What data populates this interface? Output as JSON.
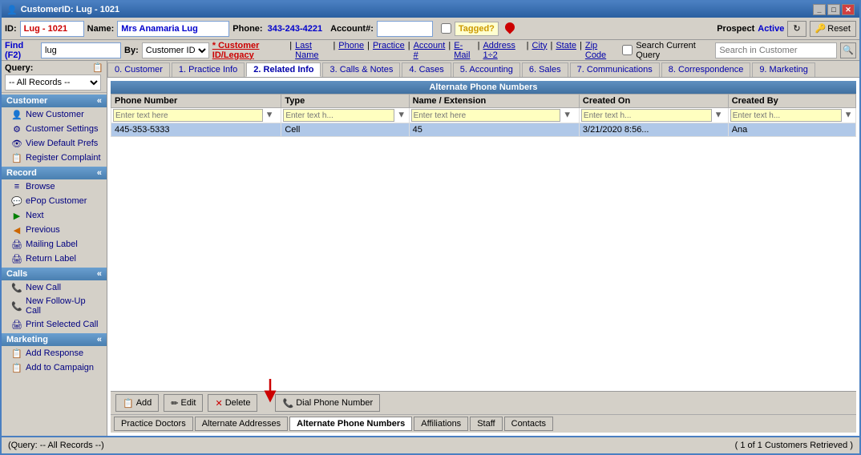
{
  "titleBar": {
    "title": "CustomerID: Lug - 1021",
    "controls": [
      "_",
      "□",
      "✕"
    ]
  },
  "idBar": {
    "idLabel": "ID:",
    "idValue": "Lug - 1021",
    "nameLabel": "Name:",
    "nameValue": "Mrs Anamaria Lug",
    "phoneLabel": "Phone:",
    "phoneValue": "343-243-4221",
    "accountLabel": "Account#:",
    "accountValue": "",
    "taggedLabel": "Tagged?",
    "prospectLabel": "Prospect",
    "activeLabel": "Active",
    "refreshLabel": "↻",
    "resetLabel": "Reset"
  },
  "findBar": {
    "label": "Find (F2)",
    "value": "lug",
    "byLabel": "By:",
    "byValue": "Customer ID",
    "navItems": [
      "* Customer ID/Legacy",
      "Last Name",
      "Phone",
      "Practice",
      "Account #",
      "E-Mail",
      "Address 1÷2",
      "City",
      "State",
      "Zip Code"
    ],
    "searchCurrentQueryLabel": "Search Current Query",
    "searchPlaceholder": "Search in Customer",
    "searchBtnIcon": "🔍"
  },
  "query": {
    "label": "Query:",
    "value": "-- All Records --",
    "icon": "📋"
  },
  "sidebar": {
    "sections": [
      {
        "name": "Customer",
        "items": [
          {
            "icon": "👤",
            "label": "New Customer"
          },
          {
            "icon": "⚙",
            "label": "Customer Settings"
          },
          {
            "icon": "👁",
            "label": "View Default Prefs"
          },
          {
            "icon": "📋",
            "label": "Register Complaint"
          }
        ]
      },
      {
        "name": "Record",
        "items": [
          {
            "icon": "≡",
            "label": "Browse"
          },
          {
            "icon": "💬",
            "label": "ePop Customer"
          },
          {
            "icon": "▶",
            "label": "Next"
          },
          {
            "icon": "◀",
            "label": "Previous"
          },
          {
            "icon": "🖨",
            "label": "Mailing Label"
          },
          {
            "icon": "🖨",
            "label": "Return Label"
          }
        ]
      },
      {
        "name": "Calls",
        "items": [
          {
            "icon": "📞",
            "label": "New Call"
          },
          {
            "icon": "📞",
            "label": "New Follow-Up Call"
          },
          {
            "icon": "🖨",
            "label": "Print Selected Call"
          }
        ]
      },
      {
        "name": "Marketing",
        "items": [
          {
            "icon": "📋",
            "label": "Add Response"
          },
          {
            "icon": "📋",
            "label": "Add to Campaign"
          }
        ]
      }
    ]
  },
  "tabs": [
    {
      "label": "0. Customer",
      "active": false
    },
    {
      "label": "1. Practice Info",
      "active": false
    },
    {
      "label": "2. Related Info",
      "active": true
    },
    {
      "label": "3. Calls & Notes",
      "active": false
    },
    {
      "label": "4. Cases",
      "active": false
    },
    {
      "label": "5. Accounting",
      "active": false
    },
    {
      "label": "6. Sales",
      "active": false
    },
    {
      "label": "7. Communications",
      "active": false
    },
    {
      "label": "8. Correspondence",
      "active": false
    },
    {
      "label": "9. Marketing",
      "active": false
    }
  ],
  "alternatePhoneNumbers": {
    "sectionTitle": "Alternate Phone Numbers",
    "columns": [
      "Phone Number",
      "Type",
      "Name / Extension",
      "Created On",
      "Created By"
    ],
    "filterPlaceholders": [
      "Enter text here",
      "Enter text h...",
      "Enter text here",
      "Enter text h...",
      "Enter text h..."
    ],
    "rows": [
      {
        "phoneNumber": "445-353-5333",
        "type": "Cell",
        "nameExtension": "45",
        "createdOn": "3/21/2020 8:56...",
        "createdBy": "Ana"
      }
    ]
  },
  "actionBar": {
    "addLabel": "Add",
    "editLabel": "Edit",
    "deleteLabel": "Delete",
    "dialLabel": "Dial Phone Number"
  },
  "bottomTabs": [
    {
      "label": "Practice Doctors"
    },
    {
      "label": "Alternate Addresses"
    },
    {
      "label": "Alternate Phone Numbers",
      "active": true
    },
    {
      "label": "Affiliations"
    },
    {
      "label": "Staff"
    },
    {
      "label": "Contacts"
    }
  ],
  "statusBar": {
    "leftText": "(Query: -- All Records --)",
    "rightText": "( 1 of 1 Customers Retrieved )"
  }
}
